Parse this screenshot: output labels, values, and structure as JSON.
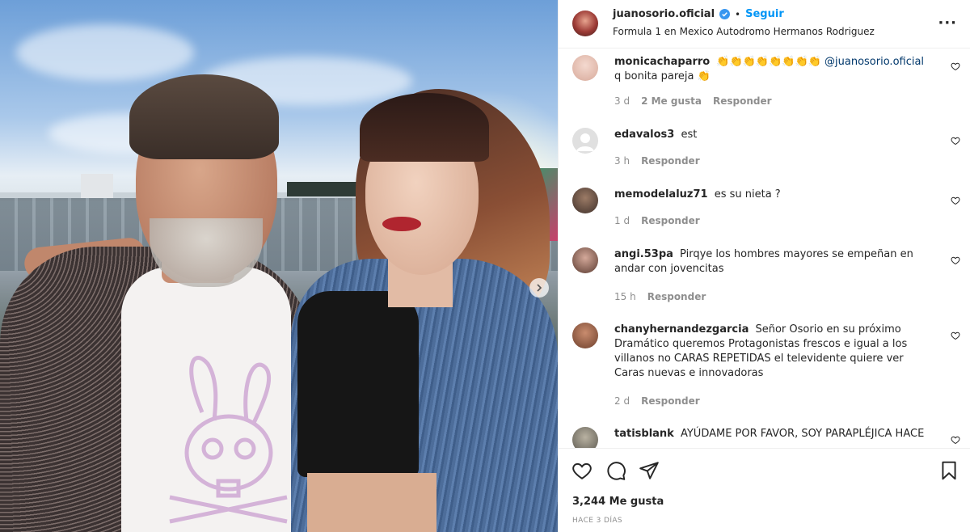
{
  "post": {
    "username": "juanosorio.oficial",
    "verified": true,
    "follow_label": "Seguir",
    "separator": "•",
    "location": "Formula 1 en Mexico Autodromo Hermanos Rodriguez",
    "more_icon": "more-options-icon"
  },
  "comments": [
    {
      "user": "monicachaparro",
      "text_emoji": "👏👏👏👏👏👏👏👏",
      "mention": "@juanosorio.oficial",
      "text": "q bonita pareja 👏",
      "time": "3 d",
      "likes": "2 Me gusta",
      "reply": "Responder"
    },
    {
      "user": "edavalos3",
      "text": "est",
      "time": "3 h",
      "reply": "Responder"
    },
    {
      "user": "memodelaluz71",
      "text": "es su nieta ?",
      "time": "1 d",
      "reply": "Responder"
    },
    {
      "user": "angi.53pa",
      "text": "Pirqye los hombres mayores se empeñan en andar con jovencitas",
      "time": "15 h",
      "reply": "Responder"
    },
    {
      "user": "chanyhernandezgarcia",
      "text": "Señor Osorio en su próximo Dramático queremos Protagonistas frescos e igual a los villanos no CARAS REPETIDAS el televidente quiere ver Caras nuevas e innovadoras",
      "time": "2 d",
      "reply": "Responder"
    },
    {
      "user": "tatisblank",
      "text": "AYÚDAME POR FAVOR, SOY PARAPLÉJICA HACE"
    }
  ],
  "footer": {
    "likes": "3,244 Me gusta",
    "date": "HACE 3 DÍAS"
  },
  "colors": {
    "accent": "#0095f6",
    "text": "#262626",
    "secondary": "#8e8e8e",
    "verified": "#3897f0"
  }
}
